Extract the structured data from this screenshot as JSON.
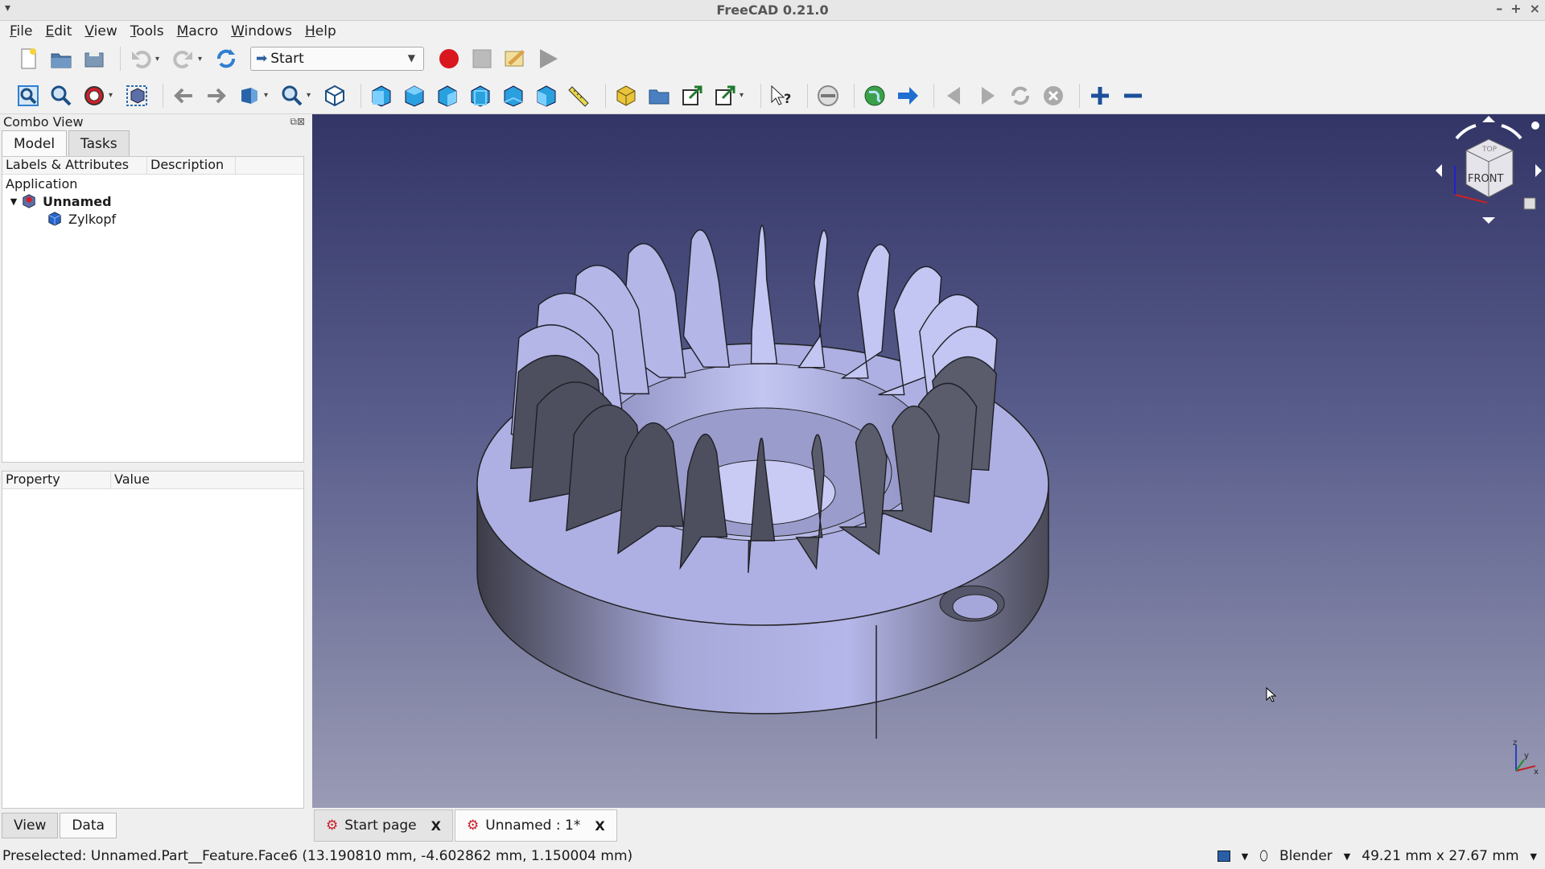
{
  "window": {
    "title": "FreeCAD 0.21.0"
  },
  "menu": [
    "File",
    "Edit",
    "View",
    "Tools",
    "Macro",
    "Windows",
    "Help"
  ],
  "workbench": {
    "selected": "Start"
  },
  "combo_view": {
    "title": "Combo View",
    "tabs": [
      "Model",
      "Tasks"
    ],
    "tree_columns": [
      "Labels & Attributes",
      "Description"
    ],
    "tree": {
      "root": "Application",
      "document": "Unnamed",
      "object": "Zylkopf"
    },
    "property_columns": [
      "Property",
      "Value"
    ],
    "bottom_tabs": [
      "View",
      "Data"
    ]
  },
  "nav_cube": {
    "front": "FRONT",
    "top": "TOP"
  },
  "axis_labels": {
    "x": "x",
    "y": "y",
    "z": "z"
  },
  "doc_tabs": [
    {
      "label": "Start page",
      "close": "X"
    },
    {
      "label": "Unnamed : 1*",
      "close": "X"
    }
  ],
  "status": {
    "message": "Preselected: Unnamed.Part__Feature.Face6 (13.190810 mm, -4.602862 mm, 1.150004 mm)",
    "nav_style": "Blender",
    "dimensions": "49.21 mm x 27.67 mm"
  },
  "colors": {
    "viewport_top": "#323566",
    "viewport_bottom": "#9a9bb5",
    "part_light": "#b7b9ec",
    "part_dark": "#4f4f5c"
  }
}
